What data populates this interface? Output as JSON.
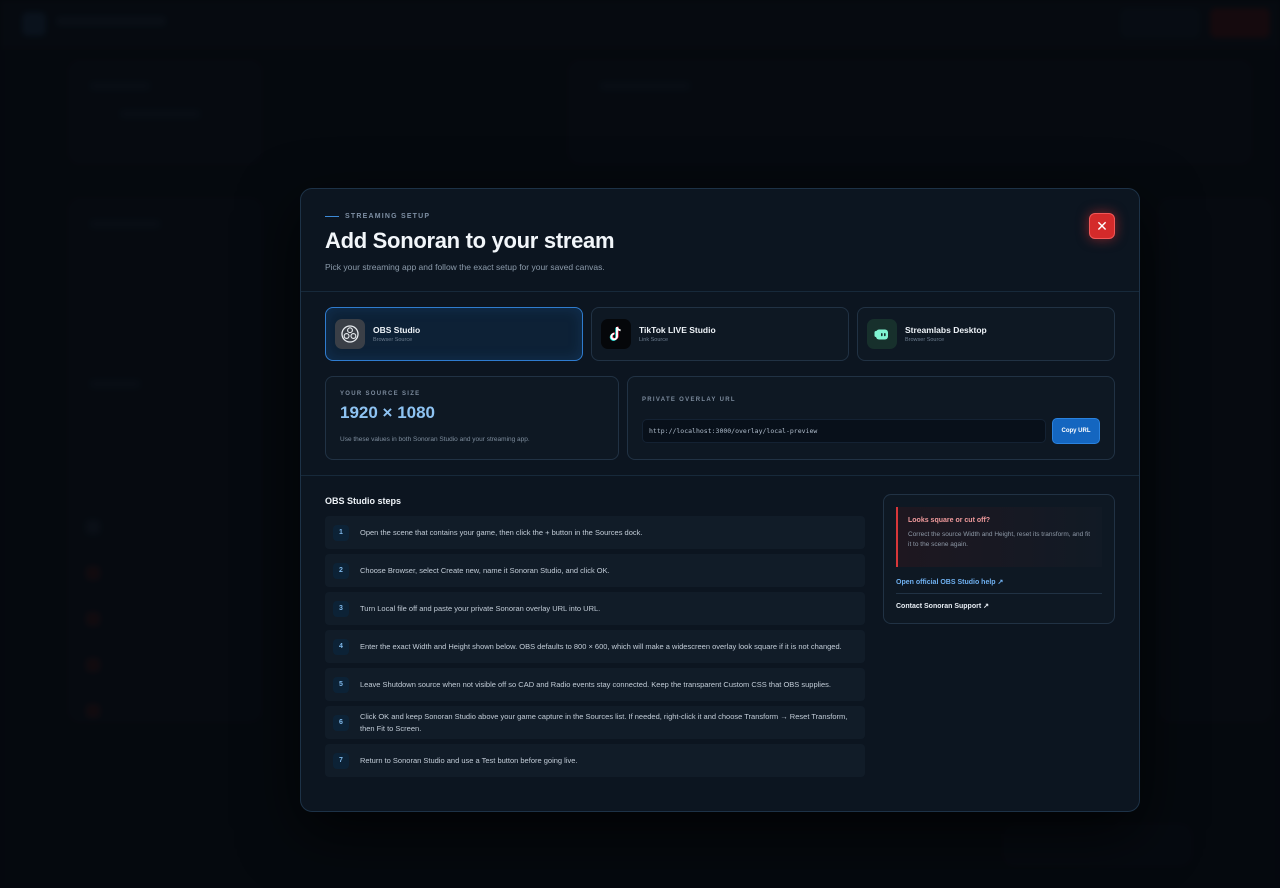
{
  "dialog": {
    "eyebrow": "STREAMING SETUP",
    "title": "Add Sonoran to your stream",
    "subtitle": "Pick your streaming app and follow the exact setup for your saved canvas.",
    "close_label": "✕"
  },
  "apps": [
    {
      "name": "OBS Studio",
      "sub": "Browser Source",
      "icon": "obs-icon",
      "selected": true
    },
    {
      "name": "TikTok LIVE Studio",
      "sub": "Link Source",
      "icon": "tiktok-icon",
      "selected": false
    },
    {
      "name": "Streamlabs Desktop",
      "sub": "Browser Source",
      "icon": "streamlabs-icon",
      "selected": false
    }
  ],
  "source_size": {
    "label": "YOUR SOURCE SIZE",
    "value": "1920 × 1080",
    "hint": "Use these values in both Sonoran Studio and your streaming app."
  },
  "overlay_url": {
    "label": "PRIVATE OVERLAY URL",
    "value": "http://localhost:3000/overlay/local-preview",
    "copy_label": "Copy URL"
  },
  "steps": {
    "title": "OBS Studio steps",
    "items": [
      {
        "num": "1",
        "text": "Open the scene that contains your game, then click the + button in the Sources dock."
      },
      {
        "num": "2",
        "text": "Choose Browser, select Create new, name it Sonoran Studio, and click OK."
      },
      {
        "num": "3",
        "text": "Turn Local file off and paste your private Sonoran overlay URL into URL."
      },
      {
        "num": "4",
        "text": "Enter the exact Width and Height shown below. OBS defaults to 800 × 600, which will make a widescreen overlay look square if it is not changed."
      },
      {
        "num": "5",
        "text": "Leave Shutdown source when not visible off so CAD and Radio events stay connected. Keep the transparent Custom CSS that OBS supplies."
      },
      {
        "num": "6",
        "text": "Click OK and keep Sonoran Studio above your game capture in the Sources list. If needed, right-click it and choose Transform → Reset Transform, then Fit to Screen."
      },
      {
        "num": "7",
        "text": "Return to Sonoran Studio and use a Test button before going live."
      }
    ]
  },
  "help": {
    "warn_title": "Looks square or cut off?",
    "warn_text": "Correct the source Width and Height, reset its transform, and fit it to the scene again.",
    "official_link": "Open official OBS Studio help ↗",
    "support_link": "Contact Sonoran Support ↗"
  },
  "colors": {
    "accent": "#2f7ccf",
    "danger": "#d42a2a",
    "size_value": "#8ec3f2"
  }
}
